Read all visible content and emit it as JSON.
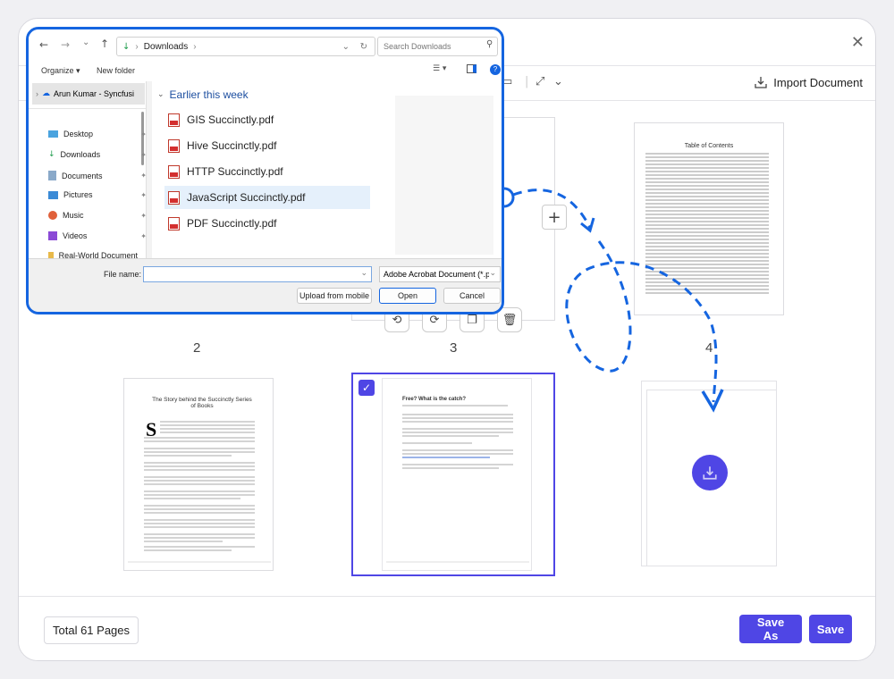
{
  "toolbar": {
    "import_label": "Import Document"
  },
  "footer": {
    "total_pages": "Total 61 Pages",
    "save_as": "Save As",
    "save": "Save"
  },
  "pages": [
    {
      "number": "2"
    },
    {
      "number": "3"
    },
    {
      "number": "4"
    }
  ],
  "thumb_texts": {
    "toc_title": "Table of Contents",
    "book_title": "The Story behind the Succinctly Series of Books",
    "free_title": "Free? What is the catch?"
  },
  "dialog": {
    "address": "Downloads",
    "search_placeholder": "Search Downloads",
    "organize": "Organize",
    "new_folder": "New folder",
    "nav_root": "Arun Kumar - Syncfusi",
    "nav_items": [
      "Desktop",
      "Downloads",
      "Documents",
      "Pictures",
      "Music",
      "Videos",
      "Real-World Document"
    ],
    "group_header": "Earlier this week",
    "files": [
      "GIS Succinctly.pdf",
      "Hive Succinctly.pdf",
      "HTTP Succinctly.pdf",
      "JavaScript Succinctly.pdf",
      "PDF Succinctly.pdf"
    ],
    "filename_label": "File name:",
    "filename_value": "",
    "filetype": "Adobe Acrobat Document (*.pc",
    "upload_mobile": "Upload from mobile",
    "open": "Open",
    "cancel": "Cancel"
  },
  "colors": {
    "accent": "#4f46e5",
    "dialog_border": "#1565e0",
    "arrow": "#1565e0"
  }
}
